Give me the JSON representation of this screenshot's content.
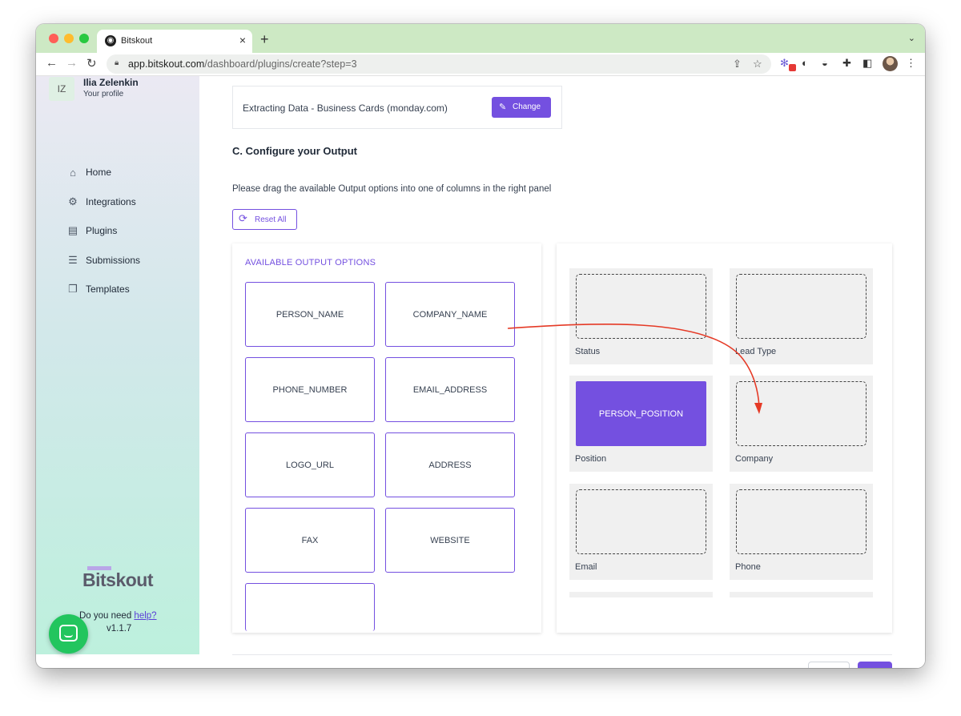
{
  "browser": {
    "tab_title": "Bitskout",
    "tab_close": "×",
    "new_tab": "+",
    "url_host": "app.bitskout.com",
    "url_path": "/dashboard/plugins/create?step=3"
  },
  "sidebar": {
    "avatar_initials": "IZ",
    "user_name": "Ilia Zelenkin",
    "user_subtitle": "Your profile",
    "items": [
      {
        "label": "Home",
        "icon": "home-icon"
      },
      {
        "label": "Integrations",
        "icon": "gear-icon"
      },
      {
        "label": "Plugins",
        "icon": "plugin-icon"
      },
      {
        "label": "Submissions",
        "icon": "list-icon"
      },
      {
        "label": "Templates",
        "icon": "templates-icon"
      }
    ],
    "logo_text": "Bitskout",
    "help_prefix": "Do you need ",
    "help_link": "help?",
    "version": "v1.1.7"
  },
  "main": {
    "plugin_name": "Extracting Data - Business Cards (monday.com)",
    "change_label": "Change",
    "section_title": "C. Configure your Output",
    "instructions": "Please drag the available Output options into one of columns in the right panel",
    "reset_label": "Reset All",
    "available_title": "AVAILABLE OUTPUT OPTIONS",
    "options": [
      "PERSON_NAME",
      "COMPANY_NAME",
      "PHONE_NUMBER",
      "EMAIL_ADDRESS",
      "LOGO_URL",
      "ADDRESS",
      "FAX",
      "WEBSITE",
      ""
    ],
    "columns": [
      {
        "label": "Status",
        "value": ""
      },
      {
        "label": "Lead Type",
        "value": ""
      },
      {
        "label": "Position",
        "value": "PERSON_POSITION"
      },
      {
        "label": "Company",
        "value": ""
      },
      {
        "label": "Email",
        "value": ""
      },
      {
        "label": "Phone",
        "value": ""
      }
    ]
  },
  "colors": {
    "accent": "#7450e0",
    "annotation_arrow": "#e53a26"
  }
}
